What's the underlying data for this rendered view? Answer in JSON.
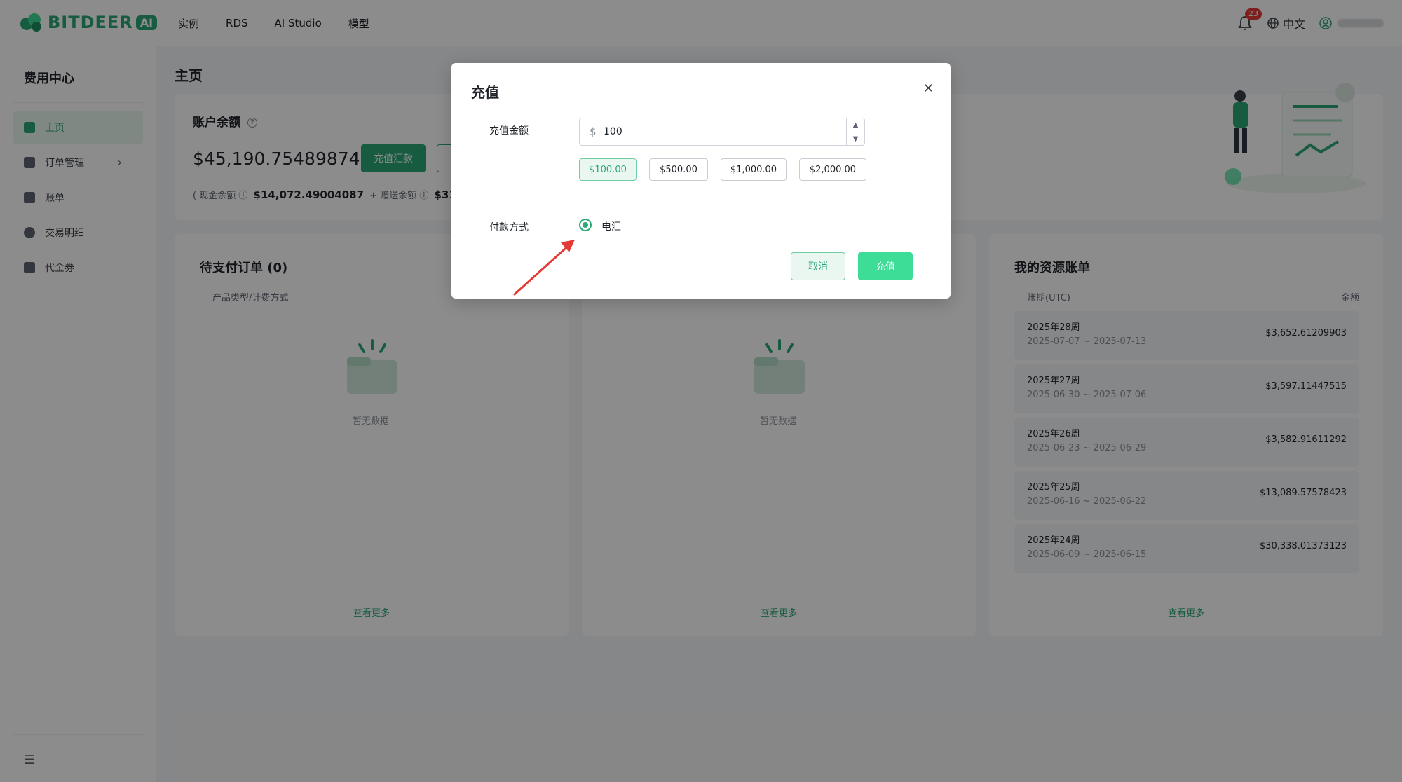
{
  "nav": {
    "logo_text": "BITDEER",
    "logo_ai": "AI",
    "links": [
      "实例",
      "RDS",
      "AI Studio",
      "模型"
    ],
    "notif_count": "23",
    "language": "中文",
    "icons": [
      "bell-icon",
      "globe-icon",
      "user-icon"
    ]
  },
  "sidebar": {
    "title": "费用中心",
    "items": [
      {
        "label": "主页",
        "icon": "home-icon"
      },
      {
        "label": "订单管理",
        "icon": "order-icon"
      },
      {
        "label": "账单",
        "icon": "bill-icon"
      },
      {
        "label": "交易明细",
        "icon": "transaction-icon"
      },
      {
        "label": "代金券",
        "icon": "voucher-icon"
      }
    ]
  },
  "main": {
    "page_title": "主页",
    "balance": {
      "title": "账户余额",
      "value": "$45,190.75489874",
      "recharge_btn": "充值汇款",
      "cash_label": "现金余额",
      "cash_value": "$14,072.49004087",
      "plus": "+",
      "gift_label": "赠送余额",
      "gift_value_partial": "$31"
    },
    "pending": {
      "title": "待支付订单 (0)",
      "col_head": "产品类型/计费方式",
      "empty": "暂无数据",
      "more": "查看更多"
    },
    "middle": {
      "empty": "暂无数据",
      "more": "查看更多"
    },
    "bills": {
      "title": "我的资源账单",
      "col_period": "账期(UTC)",
      "col_amount": "金额",
      "rows": [
        {
          "week": "2025年28周",
          "range": "2025-07-07 ~ 2025-07-13",
          "amount": "$3,652.61209903"
        },
        {
          "week": "2025年27周",
          "range": "2025-06-30 ~ 2025-07-06",
          "amount": "$3,597.11447515"
        },
        {
          "week": "2025年26周",
          "range": "2025-06-23 ~ 2025-06-29",
          "amount": "$3,582.91611292"
        },
        {
          "week": "2025年25周",
          "range": "2025-06-16 ~ 2025-06-22",
          "amount": "$13,089.57578423"
        },
        {
          "week": "2025年24周",
          "range": "2025-06-09 ~ 2025-06-15",
          "amount": "$30,338.01373123"
        }
      ],
      "more": "查看更多"
    }
  },
  "modal": {
    "title": "充值",
    "amount_label": "充值金额",
    "currency": "$",
    "amount_value": "100",
    "quick": [
      "$100.00",
      "$500.00",
      "$1,000.00",
      "$2,000.00"
    ],
    "method_label": "付款方式",
    "method_option": "电汇",
    "cancel": "取消",
    "confirm": "充值"
  },
  "colors": {
    "accent": "#2aa876",
    "accent_light": "#e9f7f0",
    "arrow": "#e53935"
  }
}
